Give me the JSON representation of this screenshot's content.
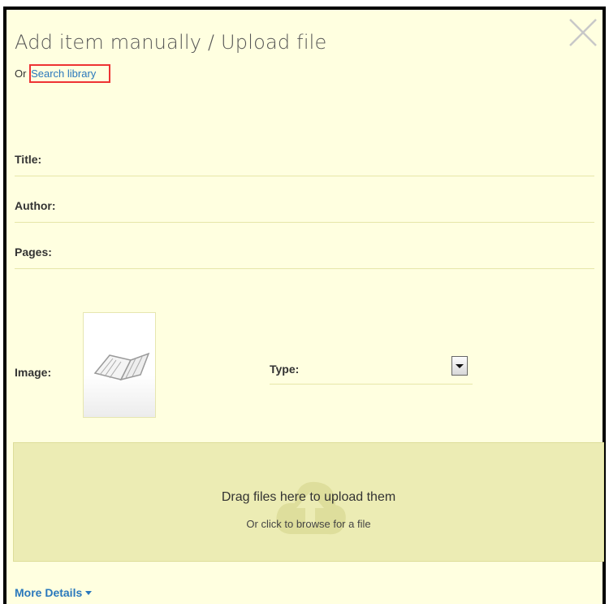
{
  "header": {
    "title": "Add item manually / Upload file",
    "or_text": "Or",
    "search_link": "Search library"
  },
  "fields": {
    "title_label": "Title:",
    "author_label": "Author:",
    "pages_label": "Pages:",
    "image_label": "Image:",
    "type_label": "Type:"
  },
  "dropzone": {
    "main_text": "Drag files here to upload them",
    "sub_text": "Or click to browse for a file"
  },
  "footer": {
    "more_details": "More Details"
  },
  "icons": {
    "close": "close-icon",
    "book": "book-icon",
    "cloud": "cloud-upload-icon",
    "chevron": "chevron-down-icon"
  },
  "colors": {
    "background": "#ffffe0",
    "link": "#2a78bc",
    "dropzone": "#ececb4",
    "highlight_box": "#ee3333"
  }
}
